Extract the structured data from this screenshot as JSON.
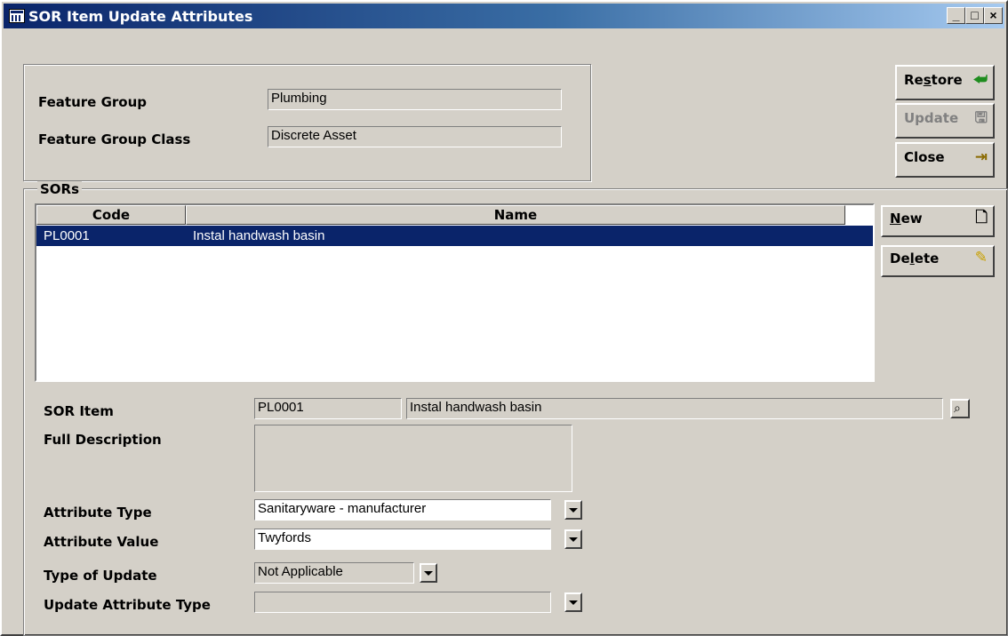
{
  "window": {
    "title": "SOR Item Update Attributes",
    "controls": {
      "minimize": "_",
      "maximize": "□",
      "close": "×"
    }
  },
  "buttons": {
    "restore": {
      "label_pre": "Re",
      "label_ul": "s",
      "label_post": "tore",
      "icon": "arrow-back-icon"
    },
    "update": {
      "label": "Update",
      "icon": "floppy-disk-icon",
      "enabled": false
    },
    "close": {
      "label": "Close",
      "icon": "door-exit-icon"
    },
    "new": {
      "label_ul": "N",
      "label_post": "ew",
      "icon": "blank-page-icon"
    },
    "delete": {
      "label_pre": "De",
      "label_ul": "l",
      "label_post": "ete",
      "icon": "eraser-icon"
    }
  },
  "feature": {
    "group_label": "Feature Group",
    "group_value": "Plumbing",
    "class_label": "Feature Group Class",
    "class_value": "Discrete Asset"
  },
  "sors": {
    "section_title": "SORs",
    "columns": [
      "Code",
      "Name"
    ],
    "rows": [
      {
        "code": "PL0001",
        "name": "Instal handwash basin",
        "selected": true
      }
    ]
  },
  "detail": {
    "sor_item_label": "SOR Item",
    "sor_item_code": "PL0001",
    "sor_item_name": "Instal handwash basin",
    "full_description_label": "Full Description",
    "full_description_value": "",
    "attribute_type_label": "Attribute Type",
    "attribute_type_value": "Sanitaryware - manufacturer",
    "attribute_value_label": "Attribute Value",
    "attribute_value_value": "Twyfords",
    "type_of_update_label": "Type of Update",
    "type_of_update_value": "Not Applicable",
    "update_attribute_type_label": "Update Attribute Type",
    "update_attribute_type_value": ""
  },
  "colors": {
    "face": "#d4d0c8",
    "selection": "#0a246a",
    "title_gradient_start": "#0a246a",
    "title_gradient_end": "#a6caf0",
    "restore_arrow": "#1e8c1e"
  }
}
